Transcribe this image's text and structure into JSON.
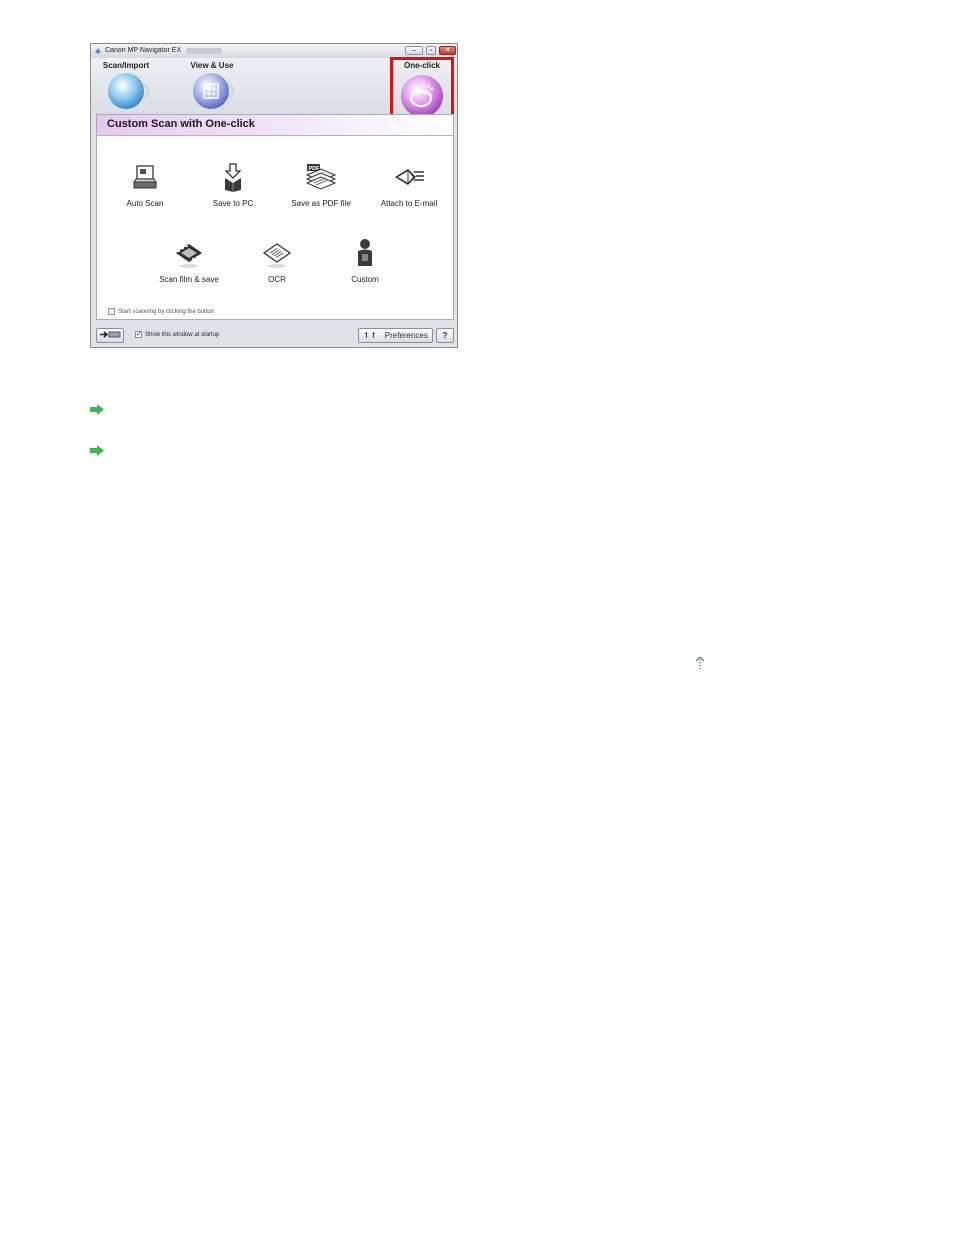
{
  "window": {
    "title": "Canon MP Navigator EX",
    "controls": [
      "minimize",
      "restore",
      "close"
    ]
  },
  "nav_tabs": [
    {
      "label": "Scan/Import",
      "icon": "scanner-icon"
    },
    {
      "label": "View & Use",
      "icon": "photo-grid-icon"
    },
    {
      "label": "One-click",
      "icon": "one-click-icon",
      "selected": true
    }
  ],
  "panel": {
    "title": "Custom Scan with One-click",
    "actions": [
      {
        "label": "Auto Scan",
        "icon": "auto-scan-icon"
      },
      {
        "label": "Save to PC",
        "icon": "save-to-pc-icon"
      },
      {
        "label": "Save as PDF file",
        "icon": "pdf-icon"
      },
      {
        "label": "Attach to E-mail",
        "icon": "email-icon"
      },
      {
        "label": "Scan film & save",
        "icon": "film-icon"
      },
      {
        "label": "OCR",
        "icon": "ocr-icon"
      },
      {
        "label": "Custom",
        "icon": "custom-person-icon"
      }
    ],
    "start_scanning_checkbox": {
      "label": "Start scanning by clicking the button",
      "checked": false
    }
  },
  "footer": {
    "show_window_checkbox": {
      "label": "Show this window at startup",
      "checked": true
    },
    "preferences_label": "Preferences",
    "help_label": "?"
  },
  "colors": {
    "highlight": "#e01010",
    "link_arrow": "#3cb84a",
    "panel_header": "#e4c9f0"
  }
}
